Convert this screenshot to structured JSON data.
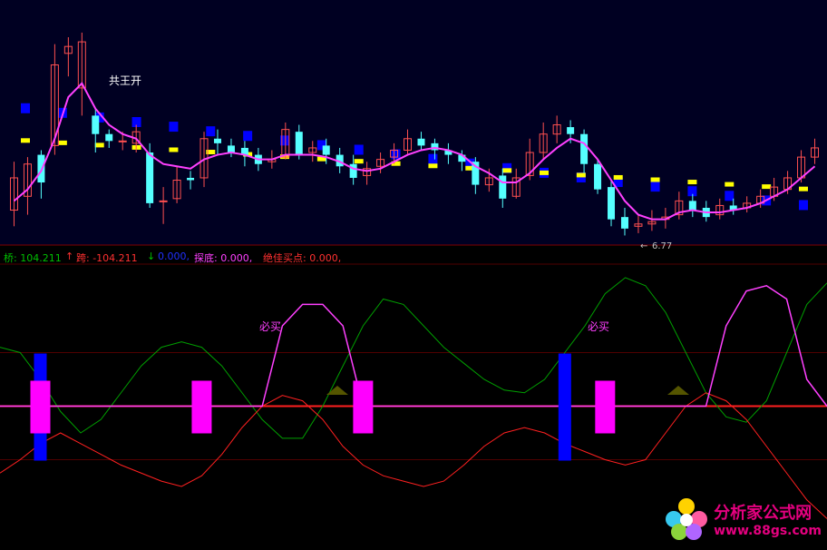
{
  "colors": {
    "background": "#000000",
    "upper_bg": "#000022",
    "candle_up": "#ff5050",
    "candle_down": "#55ffff",
    "ma_line": "#ff40ff",
    "blue_step": "#0000ff",
    "yellow_step": "#ffff00",
    "green_line": "#00a000",
    "red_line": "#ff2020",
    "magenta_bar": "#ff00ff",
    "blue_bar": "#0000ff"
  },
  "labels": {
    "upper_annotation": "共王开",
    "low_price": "6.77",
    "low_arrow": "←",
    "lower_tag_1": "必买",
    "lower_tag_2": "必买"
  },
  "indicator_bar": {
    "bridge": "桥: 104.211",
    "up_arrow": "↑",
    "leap": "跨: -104.211",
    "down_arrow": "↓",
    "zero": "0.000,",
    "probe": "探底: 0.000,",
    "best_buy": "绝佳买点: 0.000,"
  },
  "watermark": {
    "title": "分析家公式网",
    "url": "www.88gs.com"
  },
  "chart_data": [
    {
      "type": "candlestick",
      "low_label": 6.77,
      "candles": [
        [
          1.2,
          2.6,
          0.5,
          3.3
        ],
        [
          1.8,
          3.2,
          1.0,
          3.5
        ],
        [
          3.6,
          2.4,
          1.7,
          3.8
        ],
        [
          4.0,
          7.5,
          3.6,
          8.4
        ],
        [
          8.0,
          8.3,
          7.0,
          8.7
        ],
        [
          6.5,
          8.5,
          5.3,
          8.9
        ],
        [
          5.3,
          4.5,
          3.7,
          5.6
        ],
        [
          4.5,
          4.2,
          3.9,
          4.7
        ],
        [
          4.2,
          4.2,
          3.8,
          4.6
        ],
        [
          4.1,
          4.6,
          3.7,
          4.9
        ],
        [
          3.7,
          1.5,
          1.3,
          4.1
        ],
        [
          1.6,
          1.6,
          0.6,
          2.2
        ],
        [
          1.7,
          2.5,
          1.5,
          3.1
        ],
        [
          2.6,
          2.5,
          2.1,
          2.9
        ],
        [
          2.6,
          4.3,
          2.2,
          4.6
        ],
        [
          4.3,
          4.1,
          3.6,
          4.7
        ],
        [
          4.0,
          3.7,
          3.5,
          4.3
        ],
        [
          3.9,
          3.6,
          3.1,
          4.2
        ],
        [
          3.6,
          3.2,
          2.9,
          3.9
        ],
        [
          3.3,
          3.4,
          3.0,
          3.8
        ],
        [
          3.5,
          4.7,
          3.4,
          5.0
        ],
        [
          4.6,
          3.6,
          3.4,
          4.9
        ],
        [
          3.7,
          3.9,
          3.3,
          4.2
        ],
        [
          4.0,
          3.6,
          3.2,
          4.3
        ],
        [
          3.6,
          3.1,
          2.8,
          3.9
        ],
        [
          3.2,
          2.6,
          2.3,
          3.6
        ],
        [
          2.7,
          3.0,
          2.3,
          3.3
        ],
        [
          3.1,
          3.4,
          2.8,
          3.7
        ],
        [
          3.5,
          3.8,
          3.2,
          4.1
        ],
        [
          3.8,
          4.3,
          3.6,
          4.7
        ],
        [
          4.3,
          4.0,
          3.8,
          4.6
        ],
        [
          4.1,
          3.8,
          3.4,
          4.3
        ],
        [
          3.8,
          3.6,
          3.2,
          4.1
        ],
        [
          3.6,
          3.3,
          2.9,
          3.8
        ],
        [
          3.3,
          2.3,
          1.9,
          3.5
        ],
        [
          2.3,
          2.6,
          2.0,
          3.0
        ],
        [
          2.7,
          1.7,
          1.3,
          3.0
        ],
        [
          1.8,
          2.6,
          1.7,
          3.0
        ],
        [
          2.7,
          3.7,
          2.5,
          4.3
        ],
        [
          3.7,
          4.5,
          3.4,
          5.0
        ],
        [
          4.5,
          4.9,
          4.1,
          5.3
        ],
        [
          4.8,
          4.5,
          4.1,
          5.1
        ],
        [
          4.5,
          3.2,
          2.8,
          4.7
        ],
        [
          3.2,
          2.1,
          1.9,
          3.4
        ],
        [
          2.2,
          0.8,
          0.5,
          2.5
        ],
        [
          0.9,
          0.4,
          0.1,
          1.3
        ],
        [
          0.5,
          0.6,
          0.2,
          1.0
        ],
        [
          0.6,
          0.7,
          0.3,
          1.2
        ],
        [
          0.8,
          0.9,
          0.4,
          1.3
        ],
        [
          1.0,
          1.6,
          0.8,
          2.0
        ],
        [
          1.6,
          1.2,
          0.9,
          1.9
        ],
        [
          1.3,
          0.9,
          0.7,
          1.6
        ],
        [
          1.0,
          1.4,
          0.8,
          1.7
        ],
        [
          1.4,
          1.2,
          1.0,
          1.7
        ],
        [
          1.3,
          1.5,
          1.1,
          1.8
        ],
        [
          1.5,
          1.8,
          1.3,
          2.1
        ],
        [
          1.8,
          2.2,
          1.6,
          2.6
        ],
        [
          2.1,
          2.6,
          1.9,
          2.9
        ],
        [
          2.6,
          3.5,
          2.4,
          3.8
        ],
        [
          3.5,
          3.9,
          3.2,
          4.3
        ]
      ],
      "ma": [
        1.6,
        2.1,
        2.9,
        4.3,
        6.1,
        6.7,
        5.6,
        4.9,
        4.5,
        4.3,
        3.6,
        3.2,
        3.1,
        3.0,
        3.4,
        3.6,
        3.7,
        3.6,
        3.4,
        3.4,
        3.6,
        3.6,
        3.6,
        3.5,
        3.3,
        3.0,
        2.9,
        3.0,
        3.3,
        3.6,
        3.8,
        3.9,
        3.8,
        3.6,
        3.1,
        2.8,
        2.4,
        2.4,
        2.8,
        3.4,
        3.9,
        4.3,
        4.1,
        3.4,
        2.5,
        1.6,
        1.0,
        0.8,
        0.8,
        1.1,
        1.2,
        1.1,
        1.1,
        1.2,
        1.3,
        1.5,
        1.8,
        2.1,
        2.6,
        3.1
      ],
      "blue_steps": [
        5.6,
        5.4,
        5.2,
        5.0,
        4.8,
        4.6,
        4.4,
        4.2,
        4.0,
        3.8,
        3.6,
        3.4,
        3.2,
        3.0,
        2.8,
        2.6,
        2.4,
        2.2,
        2.0,
        1.8,
        1.6,
        1.4
      ],
      "yellow_steps": [
        4.2,
        4.1,
        4.0,
        3.9,
        3.8,
        3.7,
        3.6,
        3.5,
        3.4,
        3.3,
        3.2,
        3.1,
        3.0,
        2.9,
        2.8,
        2.7,
        2.6,
        2.5,
        2.4,
        2.3,
        2.2,
        2.1
      ],
      "ylim": [
        0,
        10
      ]
    },
    {
      "type": "line",
      "ylim": [
        0,
        100
      ],
      "zero_line": 50,
      "series": [
        {
          "values": [
            72,
            70,
            60,
            48,
            40,
            45,
            55,
            65,
            72,
            74,
            72,
            65,
            55,
            45,
            38,
            38,
            50,
            65,
            80,
            90,
            88,
            80,
            72,
            66,
            60,
            56,
            55,
            60,
            70,
            80,
            92,
            98,
            95,
            85,
            70,
            55,
            46,
            44,
            52,
            70,
            88,
            96
          ]
        },
        {
          "values": [
            25,
            30,
            36,
            40,
            36,
            32,
            28,
            25,
            22,
            20,
            24,
            32,
            42,
            50,
            54,
            52,
            45,
            35,
            28,
            24,
            22,
            20,
            22,
            28,
            35,
            40,
            42,
            40,
            36,
            33,
            30,
            28,
            30,
            40,
            50,
            55,
            52,
            45,
            35,
            25,
            15,
            8
          ]
        },
        {
          "values": [
            50,
            50,
            50,
            50,
            50,
            50,
            50,
            50,
            50,
            50,
            50,
            50,
            50,
            50,
            80,
            88,
            88,
            80,
            50,
            50,
            50,
            50,
            50,
            50,
            50,
            50,
            50,
            50,
            50,
            50,
            50,
            50,
            50,
            50,
            50,
            50,
            80,
            93,
            95,
            90,
            60,
            50
          ]
        }
      ],
      "bars": [
        {
          "pos": 2,
          "kind": "blue",
          "value": 1
        },
        {
          "pos": 2,
          "kind": "magenta",
          "value": 1
        },
        {
          "pos": 10,
          "kind": "magenta",
          "value": 1
        },
        {
          "pos": 18,
          "kind": "magenta",
          "value": 1
        },
        {
          "pos": 28,
          "kind": "blue",
          "value": 1
        },
        {
          "pos": 30,
          "kind": "magenta",
          "value": 1
        }
      ]
    }
  ]
}
